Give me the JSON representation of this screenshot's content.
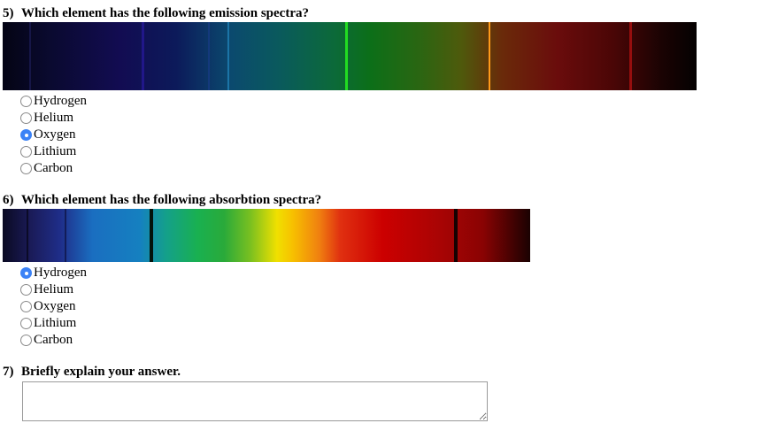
{
  "questions": [
    {
      "number": "5)",
      "text": "Which element has the following emission spectra?",
      "options": [
        "Hydrogen",
        "Helium",
        "Oxygen",
        "Lithium",
        "Carbon"
      ],
      "selected": 2
    },
    {
      "number": "6)",
      "text": "Which element has the following absorbtion spectra?",
      "options": [
        "Hydrogen",
        "Helium",
        "Oxygen",
        "Lithium",
        "Carbon"
      ],
      "selected": 0
    },
    {
      "number": "7)",
      "text": "Briefly explain your answer.",
      "answer_value": "",
      "answer_placeholder": ""
    }
  ],
  "colors": {
    "radio_checked": "#3b82f6",
    "emission_green_line": "#22dd22",
    "emission_orange_line": "#ff9a1a"
  }
}
